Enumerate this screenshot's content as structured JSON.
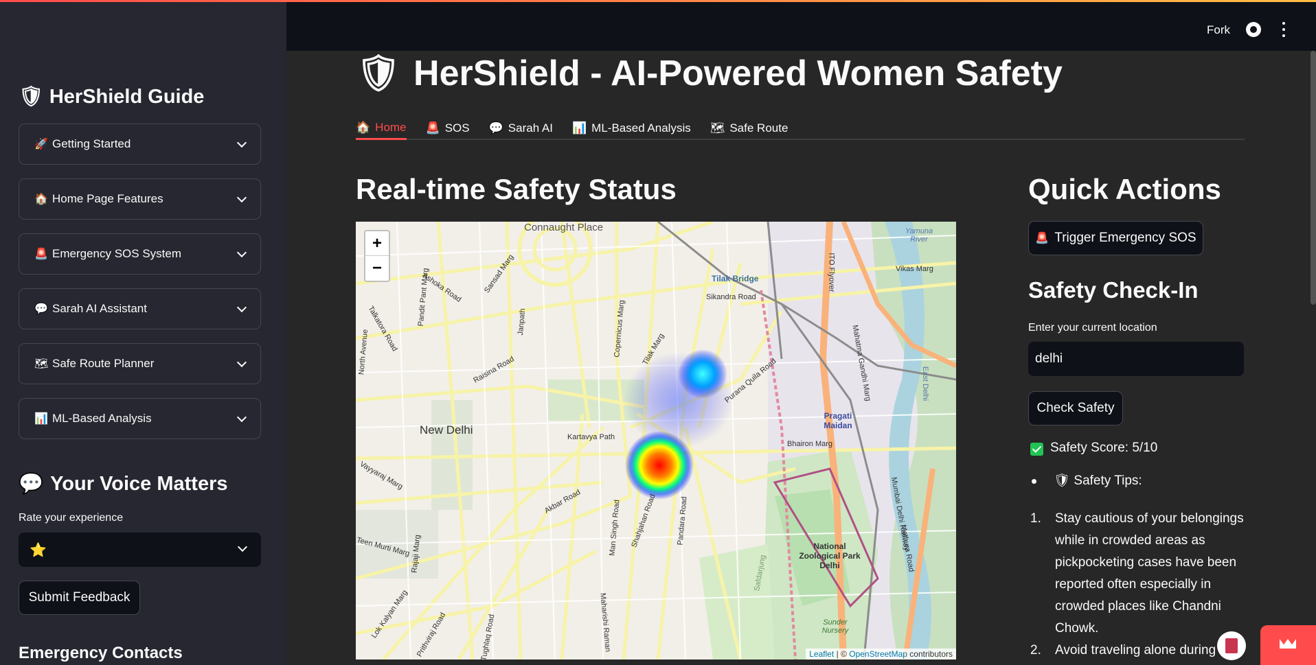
{
  "colors": {
    "accent": "#ff4b4b",
    "success": "#21c354",
    "sidebar_bg": "#262730",
    "main_bg": "#272727"
  },
  "sidebar": {
    "title": "HerShield Guide",
    "expanders": [
      {
        "icon": "rocket-icon",
        "glyph": "🚀",
        "label": "Getting Started"
      },
      {
        "icon": "house-icon",
        "glyph": "🏠",
        "label": "Home Page Features"
      },
      {
        "icon": "siren-icon",
        "glyph": "🚨",
        "label": "Emergency SOS System"
      },
      {
        "icon": "speech-bubble-icon",
        "glyph": "💬",
        "label": "Sarah AI Assistant"
      },
      {
        "icon": "map-icon",
        "glyph": "🗺",
        "label": "Safe Route Planner"
      },
      {
        "icon": "bar-chart-icon",
        "glyph": "📊",
        "label": "ML-Based Analysis"
      }
    ],
    "voice_title": "Your Voice Matters",
    "rate_label": "Rate your experience",
    "rating_value": "⭐",
    "submit_label": "Submit Feedback",
    "contacts_title": "Emergency Contacts"
  },
  "header": {
    "fork_label": "Fork"
  },
  "main": {
    "title": "HerShield - AI-Powered Women Safety",
    "tabs": [
      {
        "glyph": "🏠",
        "label": "Home",
        "active": true
      },
      {
        "glyph": "🚨",
        "label": "SOS"
      },
      {
        "glyph": "💬",
        "label": "Sarah AI"
      },
      {
        "glyph": "📊",
        "label": "ML-Based Analysis"
      },
      {
        "glyph": "🗺",
        "label": "Safe Route"
      }
    ],
    "status_title": "Real-time Safety Status",
    "map": {
      "zoom_in": "+",
      "zoom_out": "−",
      "attribution_leaflet": "Leaflet",
      "attribution_sep": " | © ",
      "attribution_osm": "OpenStreetMap",
      "attribution_tail": " contributors",
      "place_labels": [
        "Connaught Place",
        "New Delhi",
        "Tilak Bridge",
        "Pragati Maidan",
        "National Zoological Park Delhi",
        "Vikas Marg",
        "Kartavya Path",
        "Bhairon Marg",
        "Purana Quila Road",
        "Sikandra Road",
        "Akbar Road",
        "Shahjahan Road",
        "Pandara Road",
        "Ashoka Road",
        "Raisina Road",
        "Janpath",
        "Yamuna River",
        "ITO Flyover",
        "Mathura Road",
        "Sunder Nursery",
        "Lok Kalyan Marg",
        "Rajaji Marg",
        "Teen Murti Marg",
        "Tughlaq Road",
        "Maharishi Raman",
        "Copernicus Marg",
        "Tilak Marg",
        "Talkatora Road",
        "Pandit Pant Marg",
        "Sansad Marg",
        "Mahatma Gandhi Marg",
        "North Avenue",
        "Vayyaraj Marg",
        "Man Singh Road",
        "Prithviraj Road",
        "Mumbai Delhi Railway",
        "Safdarjung",
        "East Delhi"
      ]
    },
    "quick_actions_title": "Quick Actions",
    "sos_button": "Trigger Emergency SOS",
    "checkin_title": "Safety Check-In",
    "location_label": "Enter your current location",
    "location_value": "delhi",
    "check_button": "Check Safety",
    "safety_score": "Safety Score: 5/10",
    "tips_title": "🛡 Safety Tips:",
    "tips": [
      "Stay cautious of your belongings while in crowded areas as pickpocketing cases have been reported often especially in crowded places like Chandni Chowk.",
      "Avoid traveling alone during late-"
    ]
  }
}
